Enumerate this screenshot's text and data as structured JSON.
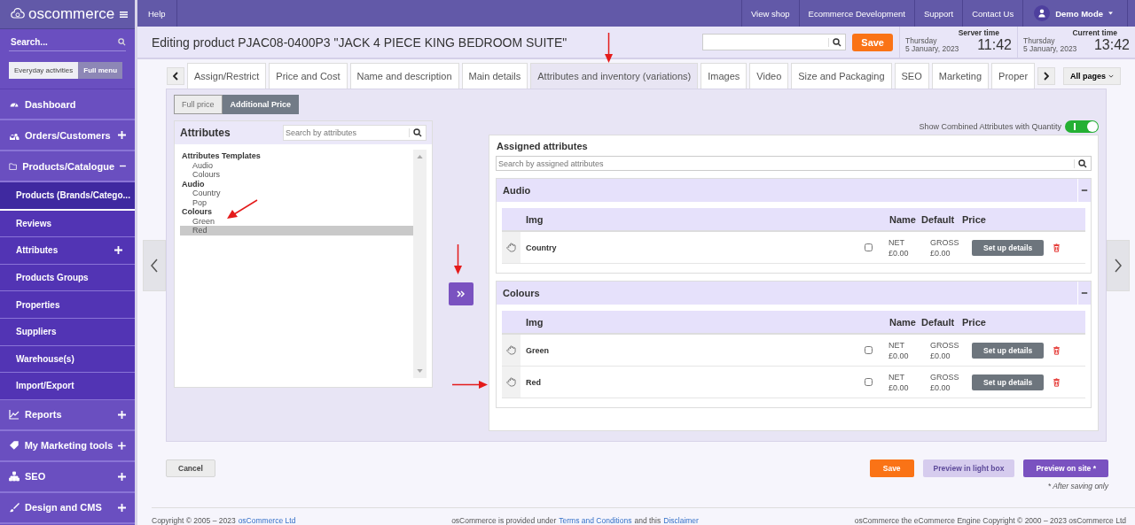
{
  "brand": {
    "name": "oscommerce"
  },
  "topbar": {
    "help": "Help",
    "links": [
      "View shop",
      "Ecommerce Development",
      "Support",
      "Contact Us"
    ],
    "user": "Demo Mode"
  },
  "sidebar": {
    "search": {
      "placeholder": "Search..."
    },
    "modes": [
      {
        "label": "Everyday activities",
        "selected": false
      },
      {
        "label": "Full menu",
        "selected": true
      }
    ],
    "items": [
      {
        "label": "Dashboard",
        "kind": "link"
      },
      {
        "label": "Orders/Customers",
        "kind": "group",
        "expanded": false
      },
      {
        "label": "Products/Catalogue",
        "kind": "group",
        "expanded": true,
        "children": [
          {
            "label": "Products (Brands/Catego...",
            "selected": true,
            "expandable": false
          },
          {
            "label": "Reviews",
            "selected": false,
            "expandable": false
          },
          {
            "label": "Attributes",
            "selected": false,
            "expandable": true
          },
          {
            "label": "Products Groups",
            "selected": false,
            "expandable": false
          },
          {
            "label": "Properties",
            "selected": false,
            "expandable": false
          },
          {
            "label": "Suppliers",
            "selected": false,
            "expandable": false
          },
          {
            "label": "Warehouse(s)",
            "selected": false,
            "expandable": false
          },
          {
            "label": "Import/Export",
            "selected": false,
            "expandable": false
          }
        ]
      },
      {
        "label": "Reports",
        "kind": "group",
        "expanded": false
      },
      {
        "label": "My Marketing tools",
        "kind": "group",
        "expanded": false
      },
      {
        "label": "SEO",
        "kind": "group",
        "expanded": false
      },
      {
        "label": "Design and CMS",
        "kind": "group",
        "expanded": false
      }
    ]
  },
  "header": {
    "title": "Editing product PJAC08-0400P3 \"JACK 4 PIECE KING BEDROOM SUITE\"",
    "save": "Save",
    "clocks": [
      {
        "label": "Server time",
        "day": "Thursday",
        "date": "5 January, 2023",
        "time": "11:42"
      },
      {
        "label": "Current time",
        "day": "Thursday",
        "date": "5 January, 2023",
        "time": "13:42"
      }
    ]
  },
  "tabs": [
    {
      "label": "Assign/Restrict",
      "selected": false
    },
    {
      "label": "Price and Cost",
      "selected": false
    },
    {
      "label": "Name and description",
      "selected": false
    },
    {
      "label": "Main details",
      "selected": false
    },
    {
      "label": "Attributes and inventory (variations)",
      "selected": true
    },
    {
      "label": "Images",
      "selected": false
    },
    {
      "label": "Video",
      "selected": false
    },
    {
      "label": "Size and Packaging",
      "selected": false
    },
    {
      "label": "SEO",
      "selected": false
    },
    {
      "label": "Marketing",
      "selected": false
    },
    {
      "label": "Proper",
      "selected": false
    }
  ],
  "all_pages": "All pages",
  "price_modes": [
    {
      "label": "Full price",
      "selected": false
    },
    {
      "label": "Additional Price",
      "selected": true
    }
  ],
  "attributes": {
    "title": "Attributes",
    "search": {
      "placeholder": "Search by attributes"
    },
    "tree": [
      {
        "label": "Attributes Templates",
        "selected": false,
        "children": [
          {
            "label": "Audio",
            "selected": false
          },
          {
            "label": "Colours",
            "selected": false
          }
        ]
      },
      {
        "label": "Audio",
        "selected": false,
        "children": [
          {
            "label": "Country",
            "selected": false
          },
          {
            "label": "Pop",
            "selected": false
          }
        ]
      },
      {
        "label": "Colours",
        "selected": false,
        "children": [
          {
            "label": "Green",
            "selected": false
          },
          {
            "label": "Red",
            "selected": true
          }
        ]
      }
    ]
  },
  "combined": {
    "label": "Show Combined Attributes with Quantity",
    "on": true
  },
  "assigned": {
    "title": "Assigned attributes",
    "search": {
      "placeholder": "Search by assigned attributes"
    },
    "groups": [
      {
        "name": "Audio",
        "expanded": true,
        "columns": [
          "Img",
          "Name",
          "Default",
          "Price"
        ],
        "rows": [
          {
            "name": "Country",
            "checked": false,
            "net": "NET",
            "net_value": "£0.00",
            "gross": "GROSS",
            "gross_value": "£0.00",
            "action": "Set up details"
          }
        ]
      },
      {
        "name": "Colours",
        "expanded": true,
        "columns": [
          "Img",
          "Name",
          "Default",
          "Price"
        ],
        "rows": [
          {
            "name": "Green",
            "checked": false,
            "net": "NET",
            "net_value": "£0.00",
            "gross": "GROSS",
            "gross_value": "£0.00",
            "action": "Set up details"
          },
          {
            "name": "Red",
            "checked": false,
            "net": "NET",
            "net_value": "£0.00",
            "gross": "GROSS",
            "gross_value": "£0.00",
            "action": "Set up details"
          }
        ]
      }
    ]
  },
  "actions": {
    "cancel": "Cancel",
    "save": "Save",
    "preview_lightbox": {
      "label": "Preview in light box",
      "disabled": true
    },
    "preview_site": "Preview on site *",
    "note": "* After saving only"
  },
  "footer": [
    [
      {
        "kind": "text",
        "text": "Copyright © 2005 – 2023"
      },
      {
        "kind": "link",
        "text": "osCommerce Ltd"
      }
    ],
    [
      {
        "kind": "text",
        "text": "osCommerce is provided under"
      },
      {
        "kind": "link",
        "text": "Terms and Conditions"
      },
      {
        "kind": "text",
        "text": "and this"
      },
      {
        "kind": "link",
        "text": "Disclaimer"
      }
    ],
    [
      {
        "kind": "text",
        "text": "osCommerce the eCommerce Engine Copyright © 2000 – 2023 osCommerce Ltd"
      }
    ]
  ]
}
